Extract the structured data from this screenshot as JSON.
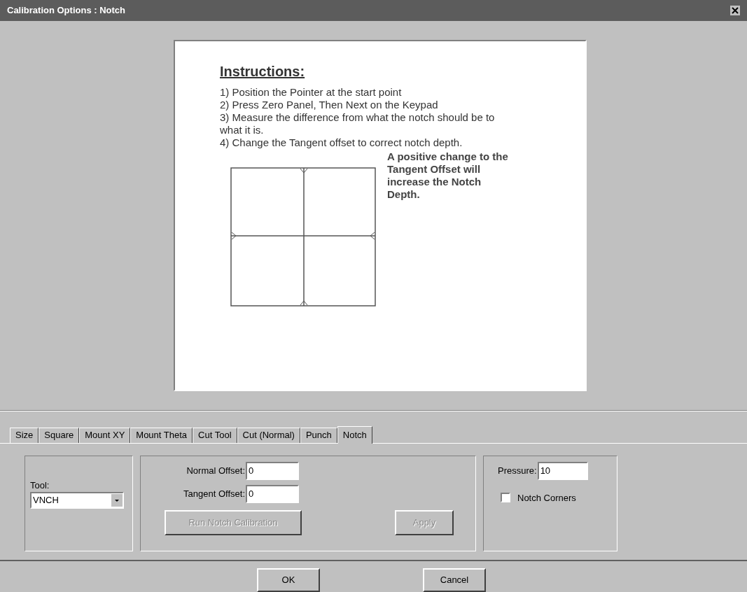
{
  "window": {
    "title": "Calibration Options : Notch"
  },
  "instructions": {
    "heading": "Instructions:",
    "steps": [
      "1) Position the Pointer at the start point",
      "2) Press Zero Panel, Then Next on the Keypad",
      "3) Measure the difference from what the notch should be to what  it is.",
      "4) Change the Tangent offset to correct notch depth."
    ],
    "note": "A positive change to the Tangent Offset will increase the Notch Depth."
  },
  "tabs": [
    {
      "label": "Size",
      "selected": false
    },
    {
      "label": "Square",
      "selected": false
    },
    {
      "label": "Mount XY",
      "selected": false
    },
    {
      "label": "Mount Theta",
      "selected": false
    },
    {
      "label": "Cut Tool",
      "selected": false
    },
    {
      "label": "Cut (Normal)",
      "selected": false
    },
    {
      "label": "Punch",
      "selected": false
    },
    {
      "label": "Notch",
      "selected": true
    }
  ],
  "tool": {
    "label": "Tool:",
    "value": "VNCH"
  },
  "offsets": {
    "normal_label": "Normal Offset:",
    "normal_value": "0",
    "tangent_label": "Tangent Offset:",
    "tangent_value": "0"
  },
  "actions": [
    {
      "label": "Run Notch Calibration",
      "disabled": true
    },
    {
      "label": "Apply",
      "disabled": true
    }
  ],
  "pressure": {
    "label": "Pressure:",
    "value": "10"
  },
  "notch_corners": {
    "label": "Notch Corners",
    "checked": false
  },
  "footer_buttons": [
    {
      "label": "OK"
    },
    {
      "label": "Cancel"
    }
  ]
}
